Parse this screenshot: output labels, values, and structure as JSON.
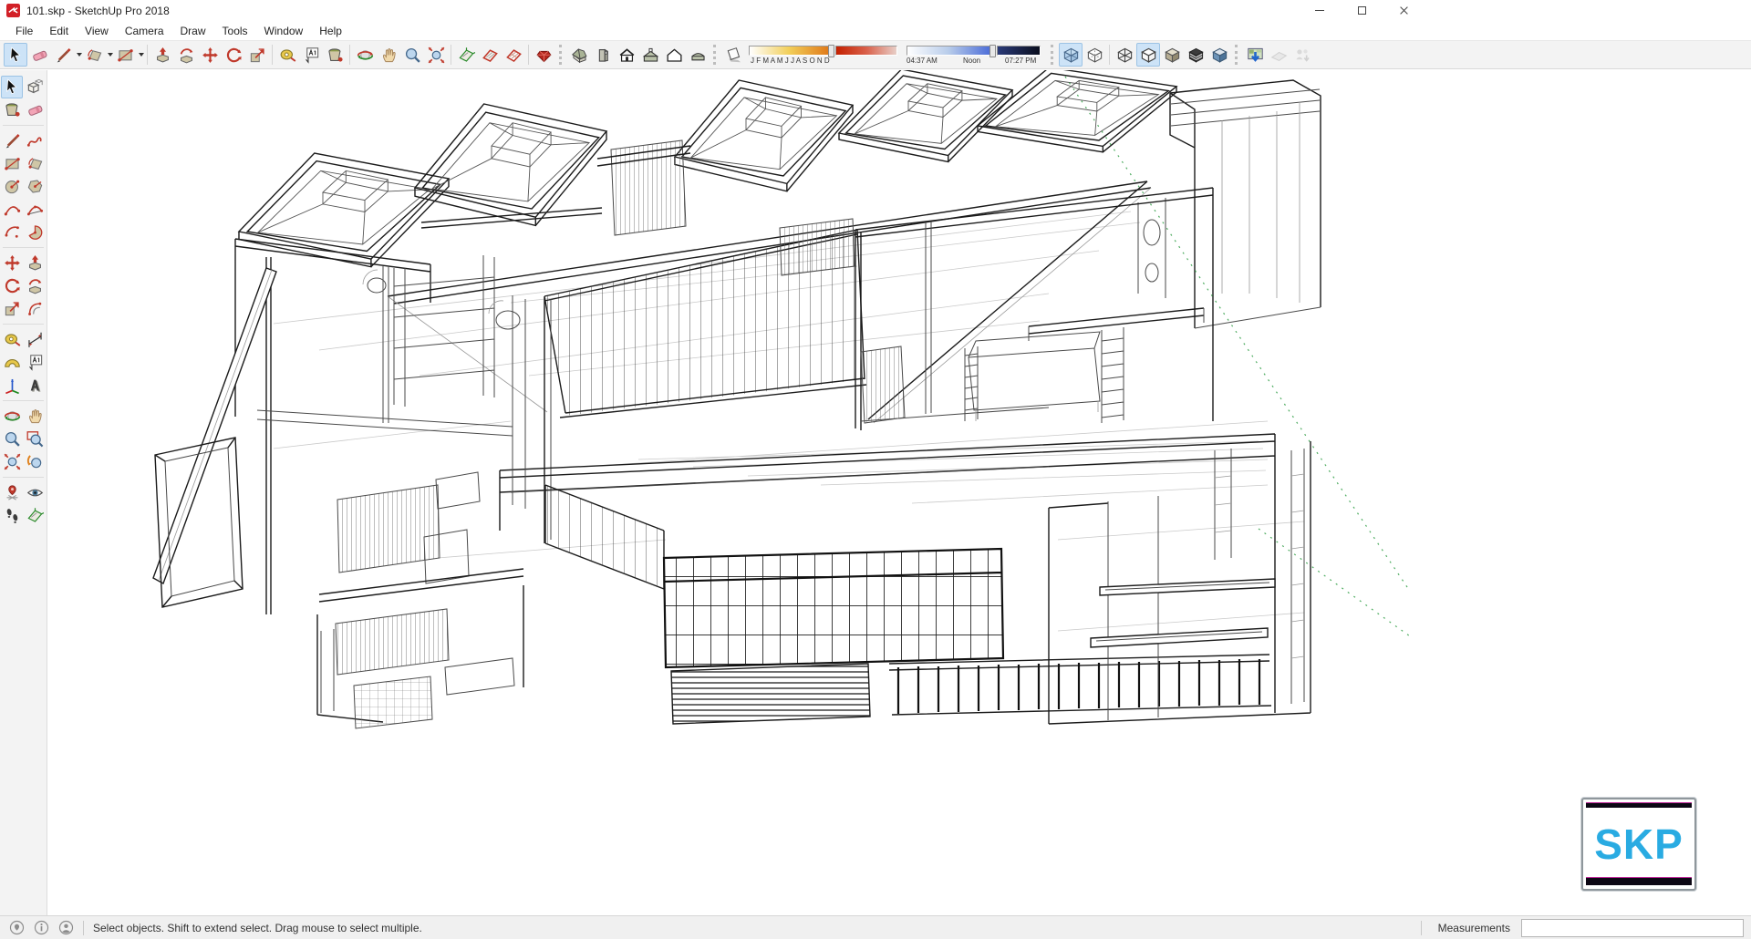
{
  "window": {
    "title": "101.skp - SketchUp Pro 2018"
  },
  "menus": [
    "File",
    "Edit",
    "View",
    "Camera",
    "Draw",
    "Tools",
    "Window",
    "Help"
  ],
  "toolbar_top": {
    "drawing": [
      "select",
      "eraser",
      "line",
      "arc",
      "rectangle"
    ],
    "edit": [
      "push-pull",
      "follow-me",
      "move",
      "rotate",
      "scale"
    ],
    "construction": [
      "tape-measure",
      "text",
      "paint-bucket"
    ],
    "camera": [
      "orbit",
      "pan",
      "zoom",
      "zoom-extents"
    ],
    "section": [
      "section-plane",
      "display-section-planes",
      "display-section-cuts"
    ],
    "warehouse": [
      "extension-warehouse"
    ],
    "views": [
      "iso",
      "right",
      "front",
      "top",
      "back",
      "left"
    ],
    "styles": [
      "x-ray",
      "back-edges",
      "wireframe",
      "hidden-line",
      "shaded",
      "shaded-with-textures",
      "monochrome"
    ],
    "sharing": [
      "get-models",
      "share-model",
      "share-component"
    ],
    "active_tools": [
      "select",
      "x-ray",
      "hidden-line"
    ],
    "disabled_tools": [
      "share-model",
      "share-component"
    ]
  },
  "shadows": {
    "months": "J F M A M J J A S O N D",
    "sunrise": "04:37 AM",
    "noon": "Noon",
    "sunset": "07:27 PM"
  },
  "left_toolbar": [
    "select",
    "make-component",
    "paint-bucket",
    "eraser",
    "line",
    "freehand",
    "rectangle",
    "rotated-rectangle",
    "circle",
    "polygon",
    "arc",
    "two-point-arc",
    "three-point-arc",
    "pie",
    "move",
    "push-pull",
    "rotate",
    "follow-me",
    "scale",
    "offset",
    "tape-measure",
    "dimension",
    "protractor",
    "text",
    "axes",
    "3d-text",
    "orbit",
    "pan",
    "zoom",
    "zoom-window",
    "zoom-extents",
    "previous-view",
    "position-camera",
    "look-around",
    "walk",
    "section-plane"
  ],
  "statusbar": {
    "icons": [
      "geolocation",
      "credits",
      "sign-in"
    ],
    "hint": "Select objects. Shift to extend select. Drag mouse to select multiple.",
    "measurements_label": "Measurements",
    "measurements_value": ""
  },
  "watermark": {
    "text": "SKP"
  },
  "colors": {
    "logo_red": "#d22027",
    "active_highlight": "#cde3f7",
    "toolbar_bg": "#f3f3f3",
    "canvas_bg": "#ffffff",
    "watermark_blue": "#29abe2",
    "guide_green": "#2f9e44"
  }
}
